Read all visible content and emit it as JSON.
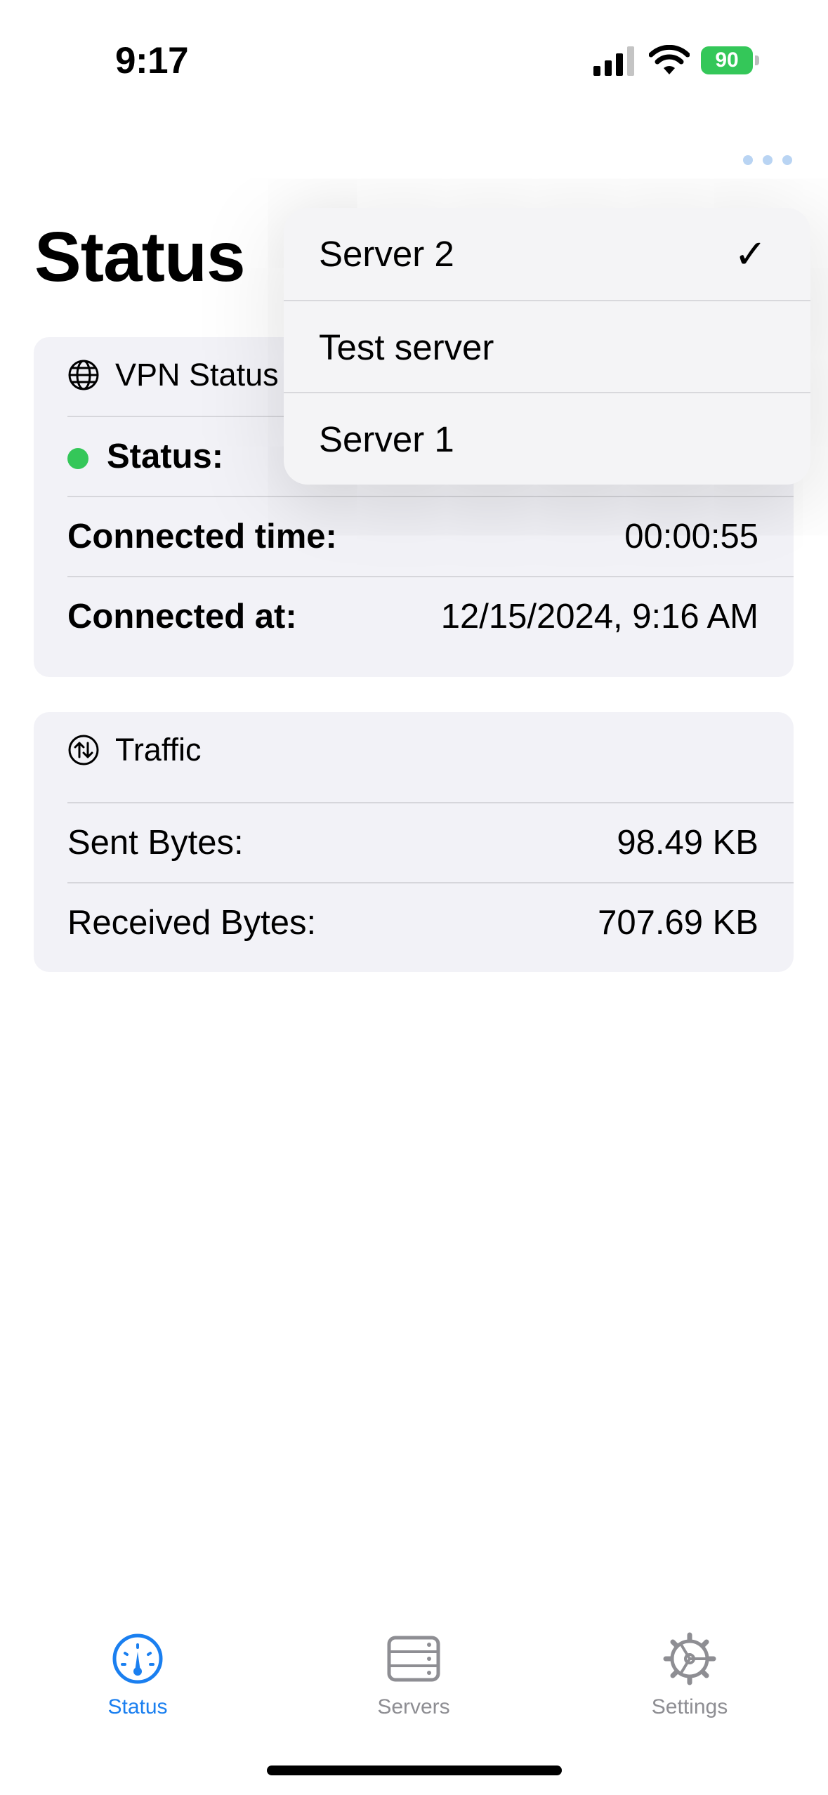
{
  "status_bar": {
    "time": "9:17",
    "battery": "90"
  },
  "nav": {
    "title": "Status"
  },
  "menu": {
    "items": [
      {
        "label": "Server 2",
        "checked": true
      },
      {
        "label": "Test server",
        "checked": false
      },
      {
        "label": "Server 1",
        "checked": false
      }
    ],
    "checkmark": "✓"
  },
  "vpn_card": {
    "header": "VPN Status",
    "rows": [
      {
        "label": "Status:",
        "value": ""
      },
      {
        "label": "Connected time:",
        "value": "00:00:55"
      },
      {
        "label": "Connected at:",
        "value": "12/15/2024, 9:16 AM"
      }
    ]
  },
  "traffic_card": {
    "header": "Traffic",
    "rows": [
      {
        "label": "Sent Bytes:",
        "value": "98.49 KB"
      },
      {
        "label": "Received Bytes:",
        "value": "707.69 KB"
      }
    ]
  },
  "tab_bar": {
    "tabs": [
      {
        "label": "Status",
        "icon": "gauge-icon",
        "active": true
      },
      {
        "label": "Servers",
        "icon": "server-rack-icon",
        "active": false
      },
      {
        "label": "Settings",
        "icon": "gear-icon",
        "active": false
      }
    ]
  },
  "colors": {
    "accent": "#1a7ff0",
    "connected": "#34c759",
    "card_bg": "#f2f2f7",
    "inactive": "#8e8e93"
  }
}
